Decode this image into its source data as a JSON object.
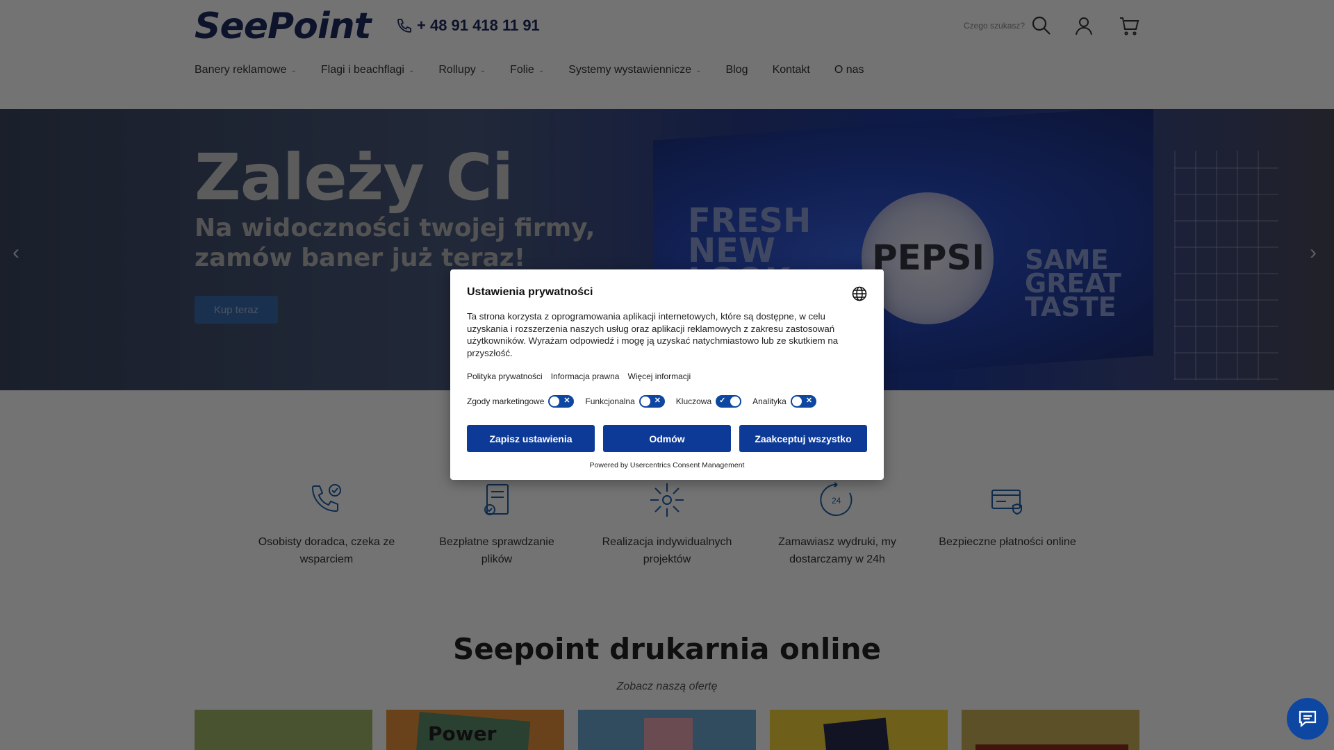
{
  "header": {
    "logo": "SeePoint",
    "phone": "+ 48 91 418 11 91",
    "search_placeholder": "Czego szukasz?"
  },
  "nav": {
    "items": [
      {
        "label": "Banery reklamowe",
        "dropdown": true
      },
      {
        "label": "Flagi i beachflagi",
        "dropdown": true
      },
      {
        "label": "Rollupy",
        "dropdown": true
      },
      {
        "label": "Folie",
        "dropdown": true
      },
      {
        "label": "Systemy wystawiennicze",
        "dropdown": true
      },
      {
        "label": "Blog",
        "dropdown": false
      },
      {
        "label": "Kontakt",
        "dropdown": false
      },
      {
        "label": "O nas",
        "dropdown": false
      }
    ]
  },
  "hero": {
    "title": "Zależy Ci",
    "subtitle": "Na widoczności twojej firmy, zamów baner już teraz!",
    "cta": "Kup teraz",
    "billboard_left": "FRESH NEW LOOK",
    "billboard_center": "PEPSI",
    "billboard_right": "SAME GREAT TASTE"
  },
  "features": [
    {
      "icon": "phone-check-icon",
      "text": "Osobisty doradca, czeka ze wsparciem"
    },
    {
      "icon": "document-check-icon",
      "text": "Bezpłatne sprawdzanie plików"
    },
    {
      "icon": "custom-project-icon",
      "text": "Realizacja indywidualnych projektów"
    },
    {
      "icon": "clock-24-icon",
      "text": "Zamawiasz wydruki, my dostarczamy w 24h"
    },
    {
      "icon": "secure-payment-icon",
      "text": "Bezpieczne płatności online"
    }
  ],
  "section": {
    "title": "Seepoint drukarnia online",
    "subtitle": "Zobacz naszą ofertę"
  },
  "products": [
    {
      "color": "#a3b86a"
    },
    {
      "color": "#e8923c",
      "label": "Power"
    },
    {
      "color": "#6aa8d0"
    },
    {
      "color": "#f3d23a"
    },
    {
      "color": "#cbb25a"
    }
  ],
  "consent": {
    "title": "Ustawienia prywatności",
    "text": "Ta strona korzysta z oprogramowania aplikacji internetowych, które są dostępne, w celu uzyskania i rozszerzenia naszych usług oraz aplikacji reklamowych z zakresu zastosowań użytkowników. Wyrażam odpowiedź i mogę ją uzyskać natychmiastowo lub ze skutkiem na przyszłość.",
    "links": [
      "Polityka prywatności",
      "Informacja prawna",
      "Więcej informacji"
    ],
    "toggles": [
      {
        "label": "Zgody marketingowe",
        "on": false
      },
      {
        "label": "Funkcjonalna",
        "on": false
      },
      {
        "label": "Kluczowa",
        "on": true
      },
      {
        "label": "Analityka",
        "on": false
      }
    ],
    "buttons": {
      "save": "Zapisz ustawienia",
      "deny": "Odmów",
      "accept": "Zaakceptuj wszystko"
    },
    "powered": "Powered by Usercentrics Consent Management"
  },
  "colors": {
    "brand": "#1d2a5e",
    "button": "#0d3a96",
    "accent": "#0d47a1"
  }
}
